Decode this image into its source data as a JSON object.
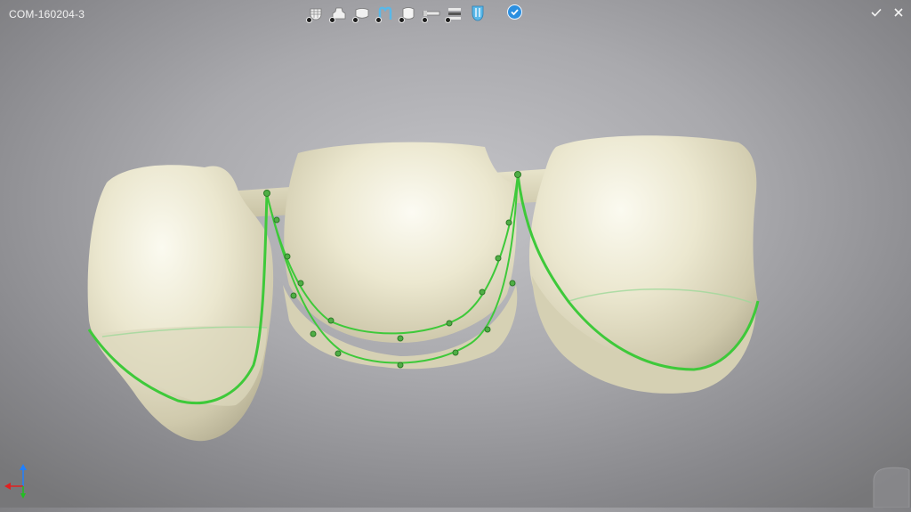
{
  "window": {
    "title": "COM-160204-3"
  },
  "toolbar": {
    "tools": [
      {
        "icon": "tooth-grid-icon",
        "has_badge": true
      },
      {
        "icon": "tooth-single-icon",
        "has_badge": true
      },
      {
        "icon": "crown-shell-icon",
        "has_badge": true
      },
      {
        "icon": "margin-line-icon",
        "has_badge": true,
        "active": true
      },
      {
        "icon": "crown-full-icon",
        "has_badge": true
      },
      {
        "icon": "connector-icon",
        "has_badge": true
      },
      {
        "icon": "sliders-icon",
        "has_badge": true
      },
      {
        "icon": "tooth-edit-icon",
        "has_badge": false,
        "active": true
      }
    ],
    "confirm_icon": "checkmark-circle-icon"
  },
  "controls": {
    "accept_icon": "checkmark-icon",
    "close_icon": "close-icon"
  },
  "scene": {
    "object": "dental-bridge-3-unit",
    "tooth_color": "#e8e4cc",
    "margin_line_color": "#3ec93a",
    "background_center": "#c4c4c8",
    "background_edge": "#777779"
  },
  "axes": {
    "x_color": "#e02020",
    "y_color": "#2080ff",
    "z_color": "#20c020"
  }
}
